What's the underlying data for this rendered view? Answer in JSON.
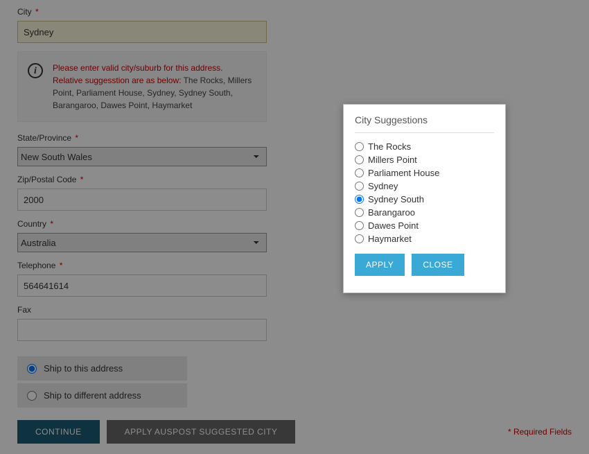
{
  "form": {
    "city": {
      "label": "City",
      "value": "Sydney",
      "required": true
    },
    "state": {
      "label": "State/Province",
      "value": "New South Wales",
      "required": true
    },
    "zip": {
      "label": "Zip/Postal Code",
      "value": "2000",
      "required": true
    },
    "country": {
      "label": "Country",
      "value": "Australia",
      "required": true
    },
    "telephone": {
      "label": "Telephone",
      "value": "564641614",
      "required": true
    },
    "fax": {
      "label": "Fax",
      "value": "",
      "required": false
    }
  },
  "error": {
    "main": "Please enter valid city/suburb for this address. Relative suggesstion are as below:",
    "suggestions": "The Rocks, Millers Point, Parliament House, Sydney, Sydney South, Barangaroo, Dawes Point, Haymarket"
  },
  "ship": {
    "same": "Ship to this address",
    "diff": "Ship to different address",
    "selected": "same"
  },
  "actions": {
    "continue": "CONTINUE",
    "apply_suggested": "APPLY AUSPOST SUGGESTED CITY",
    "required_note": "* Required Fields"
  },
  "modal": {
    "title": "City Suggestions",
    "options": [
      "The Rocks",
      "Millers Point",
      "Parliament House",
      "Sydney",
      "Sydney South",
      "Barangaroo",
      "Dawes Point",
      "Haymarket"
    ],
    "selected": "Sydney South",
    "apply": "APPLY",
    "close": "CLOSE"
  },
  "req_marker": "*"
}
